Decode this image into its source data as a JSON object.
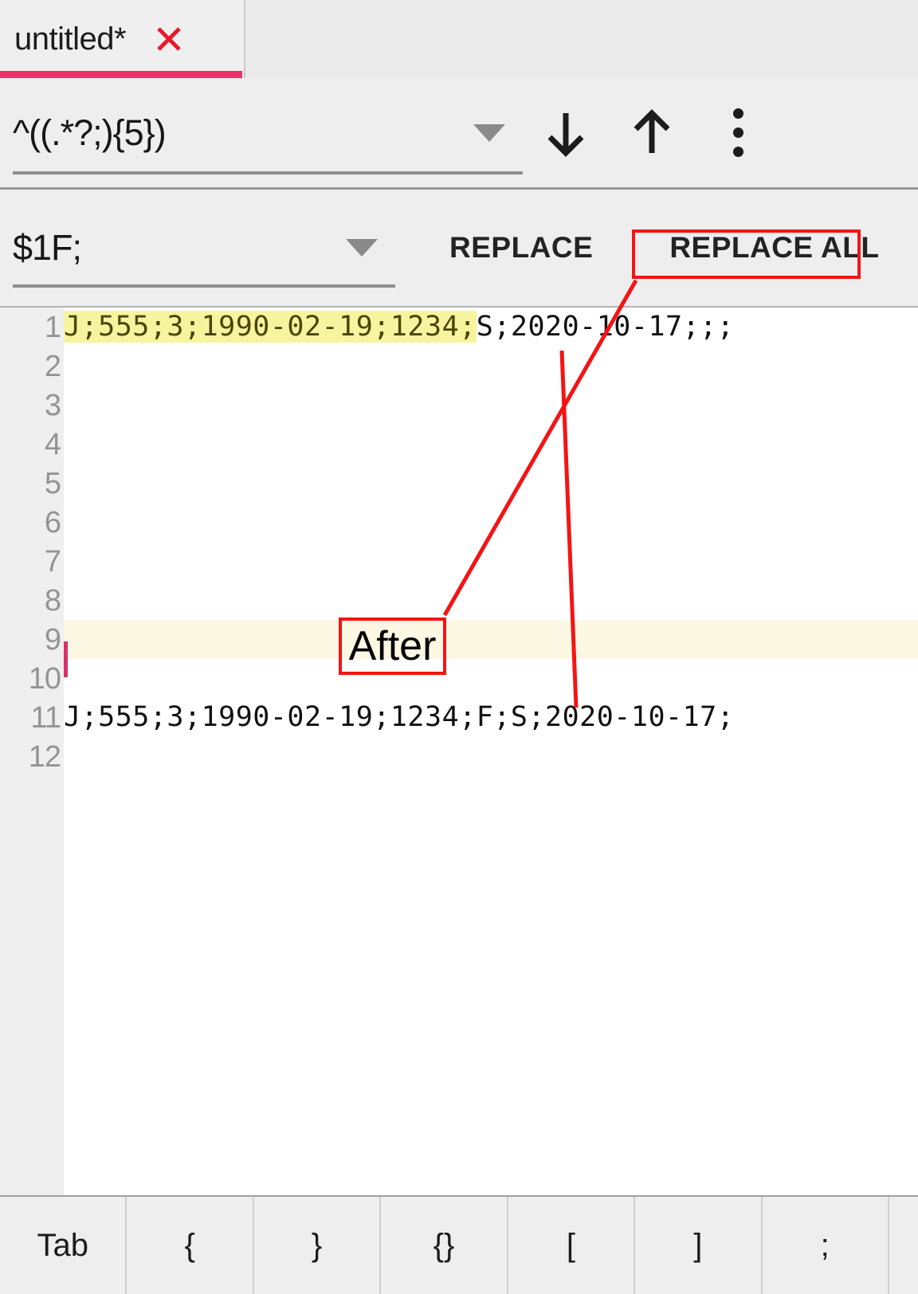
{
  "window": {
    "app_kind": "text-editor-find-replace"
  },
  "tab": {
    "title": "untitled*",
    "close_icon": "close-icon",
    "active_underline_color": "#e8336b",
    "close_color": "#e8192c"
  },
  "search_bar": {
    "query": "^((.*?;){5})",
    "query_placeholder": "Search",
    "dropdown_icon": "chevron-down-icon",
    "find_next_icon": "arrow-down-icon",
    "find_prev_icon": "arrow-up-icon",
    "overflow_icon": "more-vertical-icon"
  },
  "replace_bar": {
    "replacement": "$1F;",
    "replacement_placeholder": "Replace with",
    "dropdown_icon": "chevron-down-icon",
    "replace_label": "REPLACE",
    "replace_all_label": "REPLACE ALL"
  },
  "editor": {
    "highlight_color": "#f7f4a0",
    "current_line_color": "#fdf8e3",
    "caret_color": "#d8306a",
    "lines": [
      {
        "number": "1",
        "segments": [
          {
            "text": "J;555;3;1990-02-19;1234;",
            "highlight": true
          },
          {
            "text": "S;2020-10-17;;;",
            "highlight": false
          }
        ],
        "current": false,
        "caret": false
      },
      {
        "number": "2",
        "segments": [],
        "current": false,
        "caret": false
      },
      {
        "number": "3",
        "segments": [],
        "current": false,
        "caret": false
      },
      {
        "number": "4",
        "segments": [],
        "current": false,
        "caret": false
      },
      {
        "number": "5",
        "segments": [],
        "current": false,
        "caret": false
      },
      {
        "number": "6",
        "segments": [],
        "current": false,
        "caret": false
      },
      {
        "number": "7",
        "segments": [],
        "current": false,
        "caret": false
      },
      {
        "number": "8",
        "segments": [],
        "current": false,
        "caret": false
      },
      {
        "number": "9",
        "segments": [],
        "current": true,
        "caret": true
      },
      {
        "number": "10",
        "segments": [],
        "current": false,
        "caret": false
      },
      {
        "number": "11",
        "segments": [
          {
            "text": "J;555;3;1990-02-19;1234;F;S;2020-10-17;",
            "highlight": false
          }
        ],
        "current": false,
        "caret": false
      },
      {
        "number": "12",
        "segments": [],
        "current": false,
        "caret": false
      }
    ]
  },
  "annotations": {
    "color": "#f41414",
    "replace_all_callout": "REPLACE ALL",
    "after_label": "After"
  },
  "key_toolbar": {
    "keys": [
      "Tab",
      "{",
      "}",
      "{}",
      "[",
      "]",
      ";"
    ]
  }
}
